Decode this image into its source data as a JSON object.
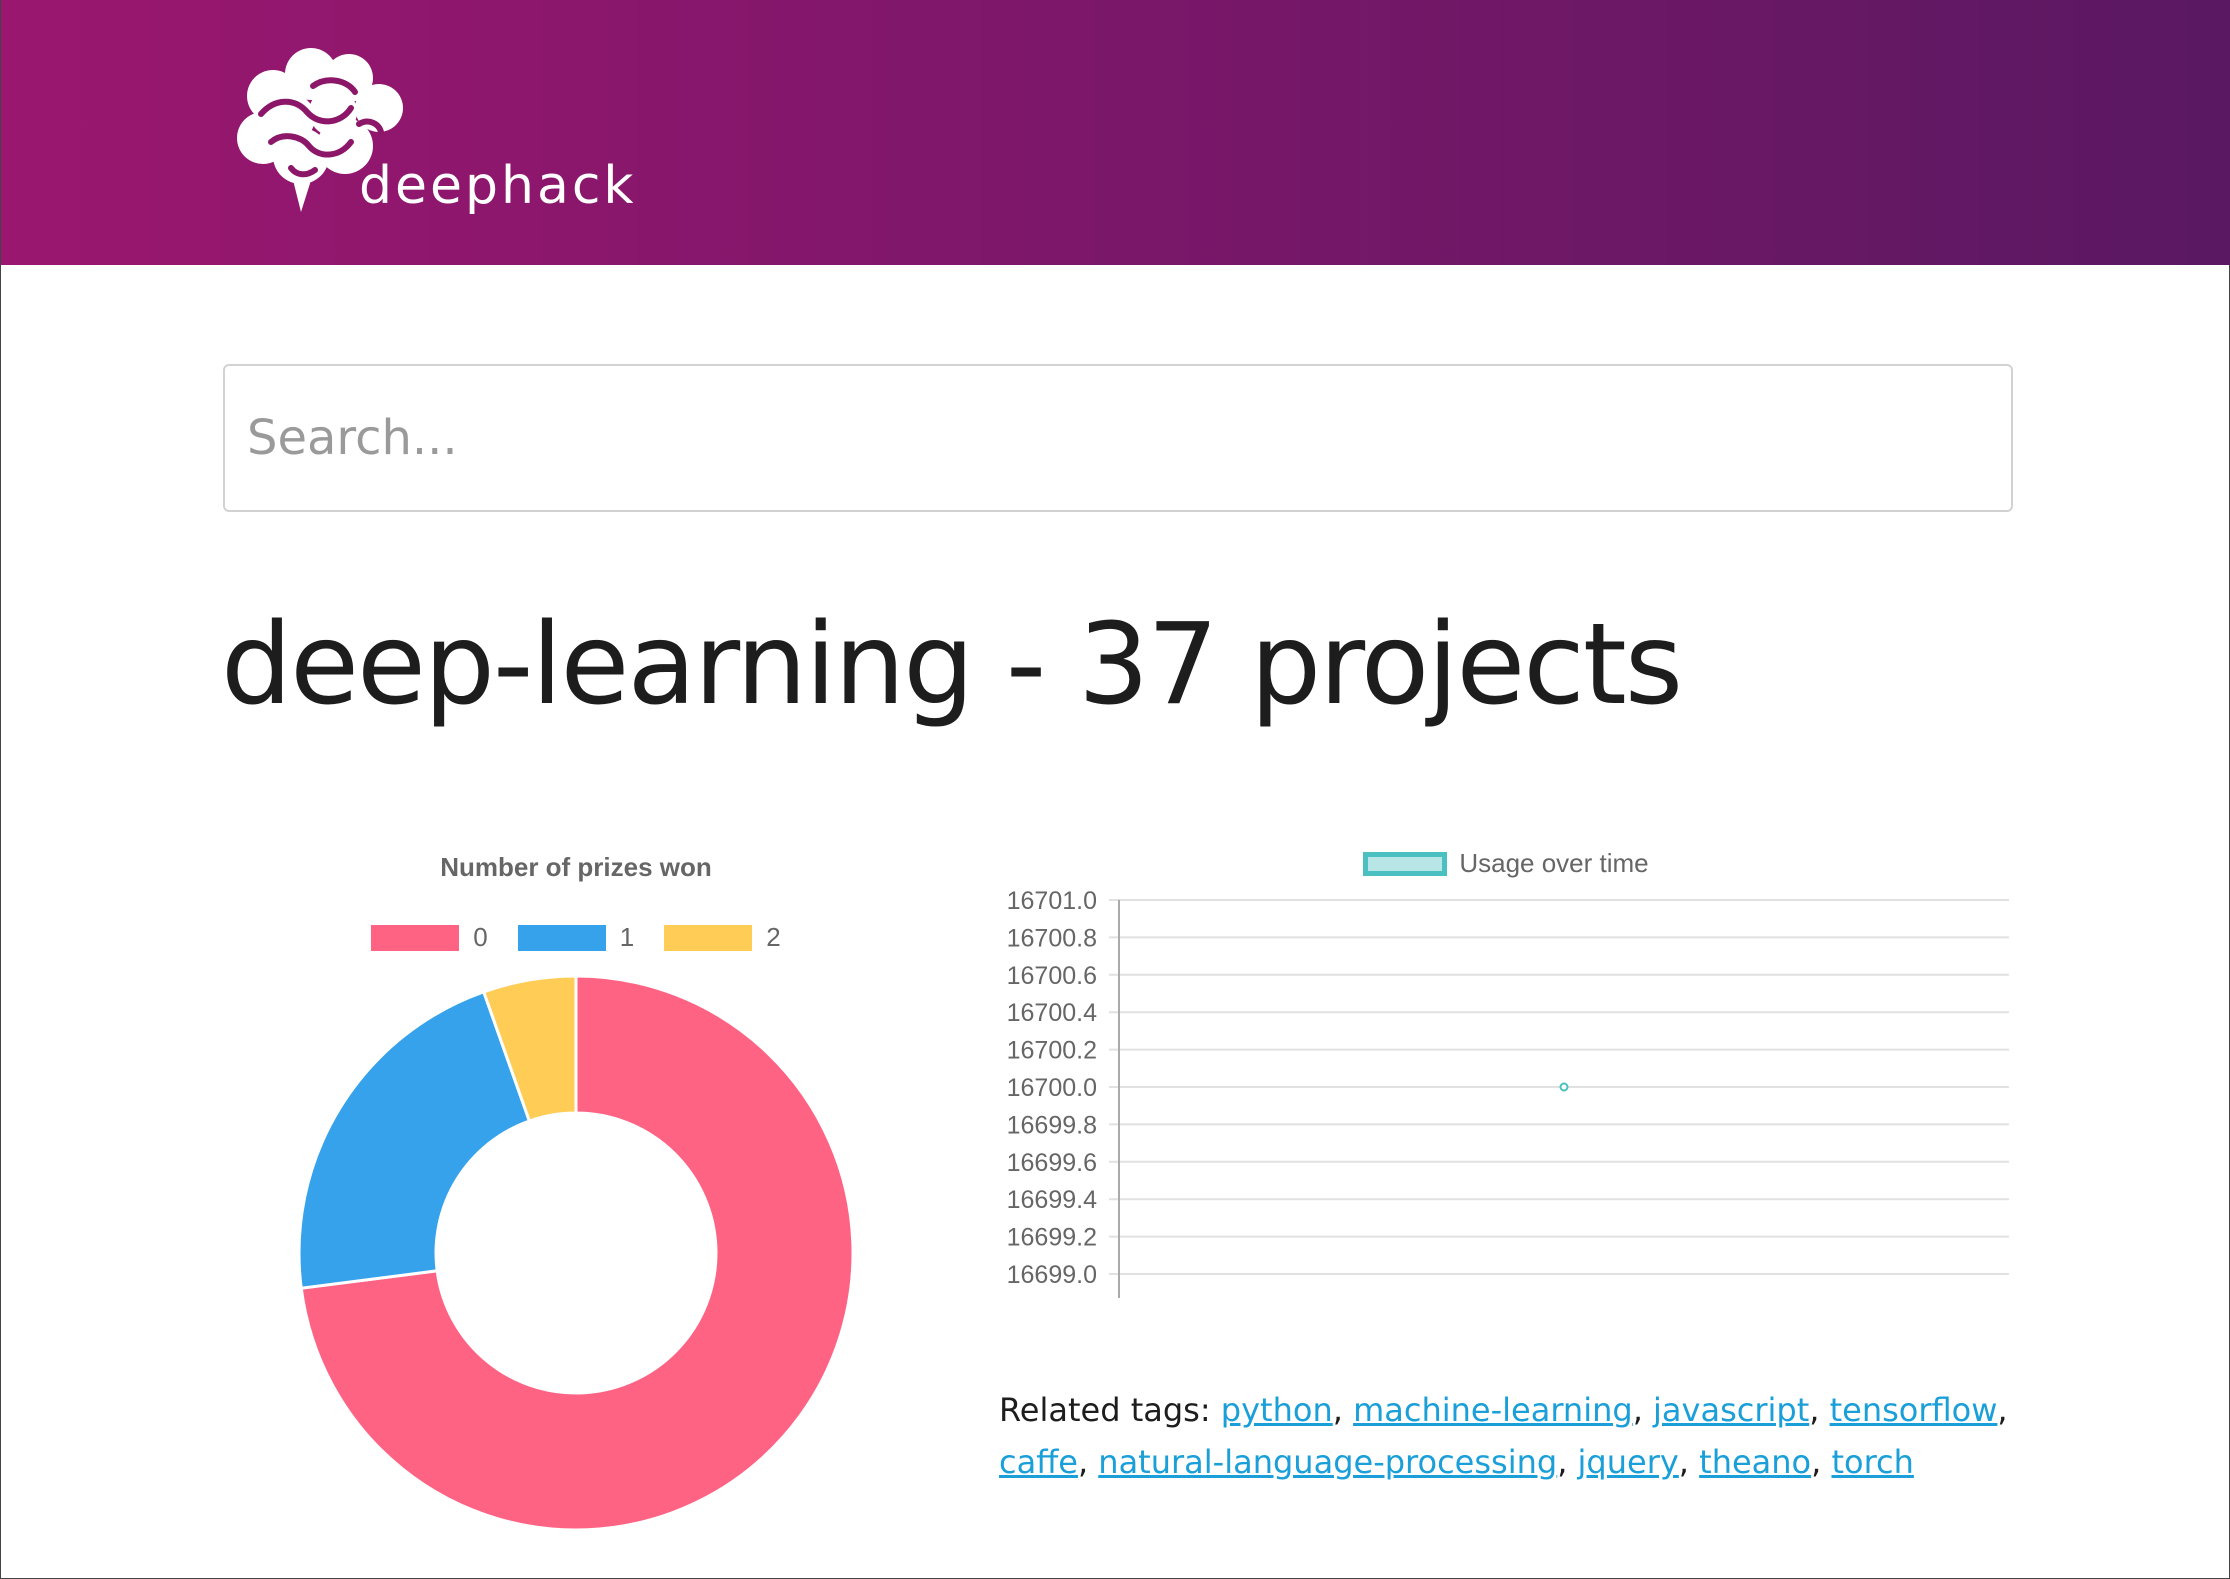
{
  "brand": {
    "name": "deephack"
  },
  "search": {
    "placeholder": "Search..."
  },
  "page": {
    "title": "deep-learning - 37 projects"
  },
  "related": {
    "label": "Related tags:",
    "tags": [
      "python",
      "machine-learning",
      "javascript",
      "tensorflow",
      "caffe",
      "natural-language-processing",
      "jquery",
      "theano",
      "torch"
    ]
  },
  "colors": {
    "brand_start": "#9b176f",
    "brand_end": "#5a1862",
    "link": "#1a9fd9"
  },
  "chart_data": [
    {
      "type": "pie",
      "variant": "doughnut",
      "title": "Number of prizes won",
      "labels": [
        "0",
        "1",
        "2"
      ],
      "values": [
        27,
        8,
        2
      ],
      "colors": [
        "#ff6384",
        "#36a2eb",
        "#ffcd56"
      ],
      "legend": "top"
    },
    {
      "type": "scatter",
      "title": "",
      "series": [
        {
          "name": "Usage over time",
          "points": [
            {
              "x": 0.5,
              "y": 16700.0
            }
          ]
        }
      ],
      "ylim": [
        16699.0,
        16701.0
      ],
      "yticks": [
        "16701.0",
        "16700.8",
        "16700.6",
        "16700.4",
        "16700.2",
        "16700.0",
        "16699.8",
        "16699.6",
        "16699.4",
        "16699.2",
        "16699.0"
      ],
      "grid": true,
      "legend": "top",
      "color": "#4bc0c0"
    }
  ]
}
